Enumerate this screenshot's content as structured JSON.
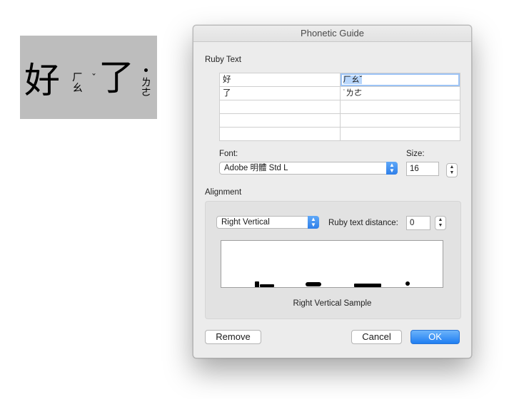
{
  "document_sample": {
    "base_char_1": "好",
    "ruby_1": "ㄏㄠ",
    "tone_1": "ˇ",
    "base_char_2": "了",
    "ruby_2": "ㄌㄜ"
  },
  "dialog": {
    "title": "Phonetic Guide",
    "ruby_text_label": "Ruby Text",
    "ruby_rows": [
      {
        "base": "好",
        "ruby": "ㄏㄠˇ"
      },
      {
        "base": "了",
        "ruby": "˙ㄌㄜ"
      },
      {
        "base": "",
        "ruby": ""
      },
      {
        "base": "",
        "ruby": ""
      },
      {
        "base": "",
        "ruby": ""
      }
    ],
    "font_label": "Font:",
    "font_value": "Adobe 明體 Std L",
    "size_label": "Size:",
    "size_value": "16",
    "alignment_label": "Alignment",
    "alignment_value": "Right Vertical",
    "distance_label": "Ruby text distance:",
    "distance_value": "0",
    "sample_caption": "Right Vertical Sample",
    "buttons": {
      "remove": "Remove",
      "cancel": "Cancel",
      "ok": "OK"
    }
  },
  "colors": {
    "accent": "#2f7fe9",
    "selection": "#b8d6fb",
    "window_bg": "#ececec"
  }
}
